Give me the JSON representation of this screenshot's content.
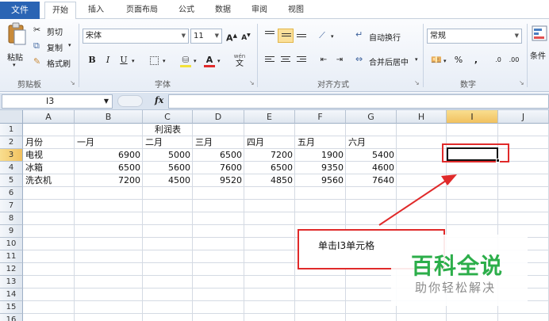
{
  "menu": {
    "file": "文件",
    "tabs": [
      "开始",
      "插入",
      "页面布局",
      "公式",
      "数据",
      "审阅",
      "视图"
    ]
  },
  "ribbon": {
    "clipboard": {
      "paste": "粘贴",
      "cut": "剪切",
      "copy": "复制",
      "format_painter": "格式刷",
      "label": "剪贴板"
    },
    "font": {
      "name": "宋体",
      "size": "11",
      "grow": "A",
      "shrink": "A",
      "bold": "B",
      "italic": "I",
      "underline": "U",
      "font_color_glyph": "A",
      "phonetic": "wén",
      "label": "字体"
    },
    "alignment": {
      "wrap": "自动换行",
      "merge": "合并后居中",
      "label": "对齐方式"
    },
    "number": {
      "format": "常规",
      "percent": "%",
      "comma": ",",
      "inc_decimal": ".0",
      "dec_decimal": ".00",
      "label": "数字"
    },
    "styles": {
      "label": "条件"
    }
  },
  "formula_bar": {
    "name_box": "I3",
    "fx": "fx",
    "formula": ""
  },
  "columns": [
    "A",
    "B",
    "C",
    "D",
    "E",
    "F",
    "G",
    "H",
    "I",
    "J"
  ],
  "rows": [
    "1",
    "2",
    "3",
    "4",
    "5",
    "6",
    "7",
    "8",
    "9",
    "10",
    "11",
    "12",
    "13",
    "14",
    "15",
    "16"
  ],
  "sheet": {
    "title": "利润表",
    "header": [
      "月份",
      "一月",
      "二月",
      "三月",
      "四月",
      "五月",
      "六月"
    ],
    "data": [
      [
        "电视",
        "6900",
        "5000",
        "6500",
        "7200",
        "1900",
        "5400"
      ],
      [
        "冰箱",
        "6500",
        "5600",
        "7600",
        "6500",
        "9350",
        "4600"
      ],
      [
        "洗衣机",
        "7200",
        "4500",
        "9520",
        "4850",
        "9560",
        "7640"
      ]
    ]
  },
  "selected_column": "I",
  "selected_row": "3",
  "annotation": {
    "text": "单击I3单元格",
    "color": "#e02a2a"
  },
  "watermark": {
    "title": "百科全说",
    "subtitle": "助你轻松解决",
    "color": "#2cae4a"
  }
}
